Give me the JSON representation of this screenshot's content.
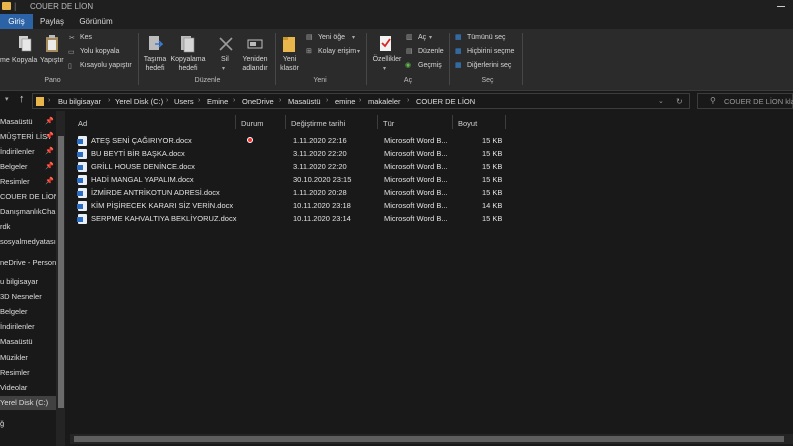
{
  "window": {
    "title": "COUER DE LİON"
  },
  "tabs": [
    {
      "label": "Giriş"
    },
    {
      "label": "Paylaş"
    },
    {
      "label": "Görünüm"
    }
  ],
  "ribbon": {
    "pano": {
      "label": "Pano",
      "sabitle": "me",
      "kopyala": "Kopyala",
      "yapistir": "Yapıştır",
      "kes": "Kes",
      "yolu_kopyala": "Yolu kopyala",
      "kisayolu_yapistir": "Kısayolu yapıştır"
    },
    "duzenle": {
      "label": "Düzenle",
      "tasima_1": "Taşıma",
      "tasima_2": "hedefi",
      "kopyalama_1": "Kopyalama",
      "kopyalama_2": "hedefi",
      "sil": "Sil",
      "yeniden_1": "Yeniden",
      "yeniden_2": "adlandır"
    },
    "yeni": {
      "label": "Yeni",
      "yeni_1": "Yeni",
      "yeni_2": "klasör",
      "yeni_oge": "Yeni öğe",
      "kolay_erisim": "Kolay erişim"
    },
    "ac": {
      "label": "Aç",
      "ozellikler": "Özellikler",
      "ac": "Aç",
      "duzenle": "Düzenle",
      "gecmis": "Geçmiş"
    },
    "sec": {
      "label": "Seç",
      "tumunu_sec": "Tümünü seç",
      "hicbirini_secme": "Hiçbirini seçme",
      "digerlerini_sec": "Diğerlerini seç"
    }
  },
  "breadcrumb": [
    "Bu bilgisayar",
    "Yerel Disk (C:)",
    "Users",
    "Emine",
    "OneDrive",
    "Masaüstü",
    "emine",
    "makaleler",
    "COUER DE LİON"
  ],
  "search": {
    "placeholder": "COUER DE LİON klası"
  },
  "nav": [
    {
      "label": "Masaüstü",
      "pinned": true
    },
    {
      "label": "MÜŞTERİ LİST",
      "pinned": true
    },
    {
      "label": "İndirilenler",
      "pinned": true
    },
    {
      "label": "Belgeler",
      "pinned": true
    },
    {
      "label": "Resimler",
      "pinned": true
    },
    {
      "label": "COUER DE LİON",
      "pinned": false
    },
    {
      "label": "DanışmanlıkCha",
      "pinned": false
    },
    {
      "label": "rdk",
      "pinned": false
    },
    {
      "label": "sosyalmedyatası",
      "pinned": false
    },
    {
      "label": "neDrive - Person",
      "pinned": false
    },
    {
      "label": "u bilgisayar",
      "pinned": false
    },
    {
      "label": "3D Nesneler",
      "pinned": false
    },
    {
      "label": "Belgeler",
      "pinned": false
    },
    {
      "label": "İndirilenler",
      "pinned": false
    },
    {
      "label": "Masaüstü",
      "pinned": false
    },
    {
      "label": "Müzikler",
      "pinned": false
    },
    {
      "label": "Resimler",
      "pinned": false
    },
    {
      "label": "Videolar",
      "pinned": false
    },
    {
      "label": "Yerel Disk (C:)",
      "pinned": false
    },
    {
      "label": "ğ",
      "pinned": false
    }
  ],
  "columns": {
    "name": "Ad",
    "status": "Durum",
    "modified": "Değiştirme tarihi",
    "type": "Tür",
    "size": "Boyut"
  },
  "files": [
    {
      "name": "ATEŞ SENİ ÇAĞIRIYOR.docx",
      "modified": "1.11.2020 22:16",
      "type": "Microsoft Word B...",
      "size": "15 KB",
      "sync_error": true
    },
    {
      "name": "BU BEYTİ BİR BAŞKA.docx",
      "modified": "3.11.2020 22:20",
      "type": "Microsoft Word B...",
      "size": "15 KB",
      "sync_error": false
    },
    {
      "name": "GRİLL HOUSE DENİNCE.docx",
      "modified": "3.11.2020 22:20",
      "type": "Microsoft Word B...",
      "size": "15 KB",
      "sync_error": false
    },
    {
      "name": "HADİ MANGAL YAPALIM.docx",
      "modified": "30.10.2020 23:15",
      "type": "Microsoft Word B...",
      "size": "15 KB",
      "sync_error": false
    },
    {
      "name": "İZMİRDE ANTRİKOTUN ADRESİ.docx",
      "modified": "1.11.2020 20:28",
      "type": "Microsoft Word B...",
      "size": "15 KB",
      "sync_error": false
    },
    {
      "name": "KİM PİŞİRECEK KARARI SİZ VERİN.docx",
      "modified": "10.11.2020 23:18",
      "type": "Microsoft Word B...",
      "size": "14 KB",
      "sync_error": false
    },
    {
      "name": "SERPME KAHVALTIYA BEKLİYORUZ.docx",
      "modified": "10.11.2020 23:14",
      "type": "Microsoft Word B...",
      "size": "15 KB",
      "sync_error": false
    }
  ],
  "colors": {
    "accent": "#2b63a6",
    "folder": "#e8b64a",
    "word_blue": "#2b6cc4",
    "sync_error": "#e33333"
  }
}
